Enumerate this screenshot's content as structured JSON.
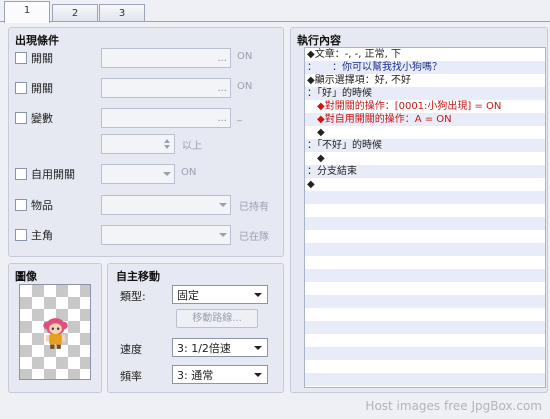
{
  "tabs": [
    "1",
    "2",
    "3"
  ],
  "conditions": {
    "title": "出現條件",
    "switch1": {
      "label": "開關",
      "value": "...",
      "hint": "ON"
    },
    "switch2": {
      "label": "開關",
      "value": "...",
      "hint": "ON"
    },
    "variable": {
      "label": "變數",
      "value": "...",
      "hint": "_",
      "number_hint": "以上"
    },
    "self_switch": {
      "label": "自用開關",
      "hint": "ON"
    },
    "item": {
      "label": "物品",
      "hint": "已持有"
    },
    "actor": {
      "label": "主角",
      "hint": "已在隊"
    }
  },
  "image": {
    "title": "圖像"
  },
  "move": {
    "title": "自主移動",
    "type_label": "類型:",
    "type_value": "固定",
    "route_button": "移動路線...",
    "speed_label": "速度",
    "speed_value": "3: 1/2倍速",
    "freq_label": "頻率",
    "freq_value": "3: 通常"
  },
  "event": {
    "title": "執行內容",
    "lines": [
      {
        "text": "◆文章：-, -, 正常, 下",
        "color": "dark"
      },
      {
        "text": "：　　：你可以幫我找小狗嗎？",
        "color": "blue"
      },
      {
        "text": "◆顯示選擇項：好, 不好",
        "color": "dark"
      },
      {
        "text": "：「好」的時候",
        "color": "dark"
      },
      {
        "text": "　◆對開關的操作：[0001:小狗出現] = ON",
        "color": "red"
      },
      {
        "text": "　◆對自用開關的操作：A = ON",
        "color": "red"
      },
      {
        "text": "　◆",
        "color": "dark"
      },
      {
        "text": "：「不好」的時候",
        "color": "dark"
      },
      {
        "text": "　◆",
        "color": "dark"
      },
      {
        "text": "：分支結束",
        "color": "dark"
      },
      {
        "text": "◆",
        "color": "dark"
      }
    ]
  },
  "footer": "Host images free JpgBox.com"
}
